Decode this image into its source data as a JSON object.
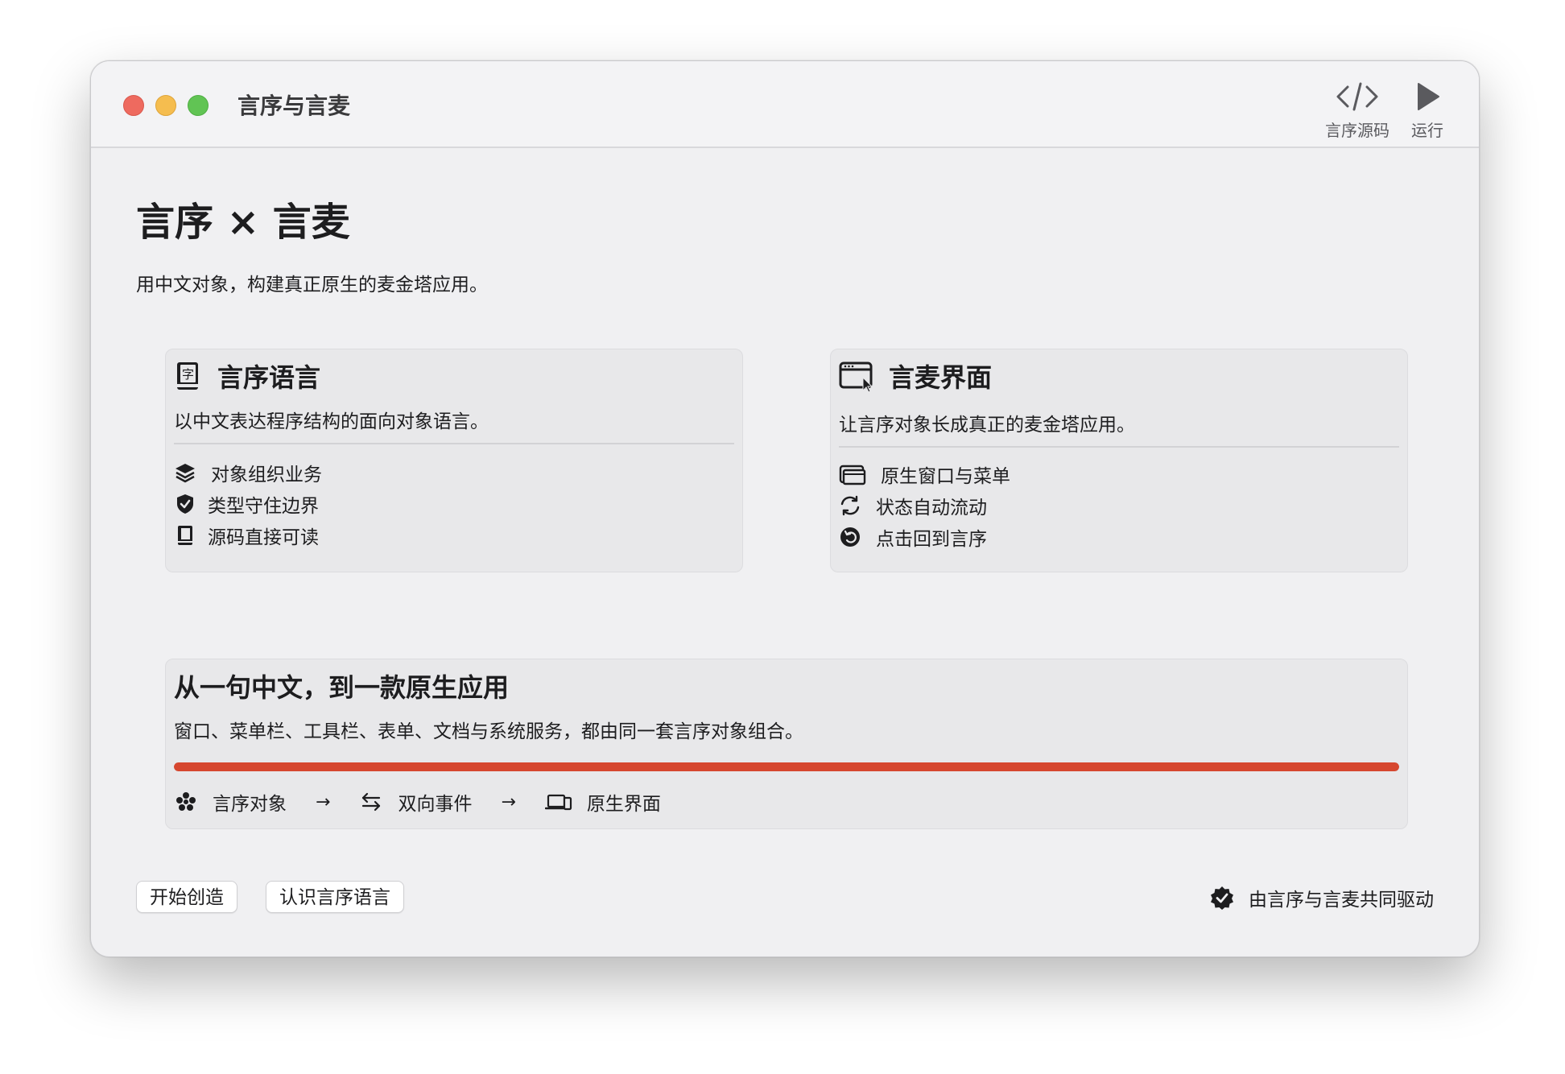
{
  "window": {
    "title": "言序与言麦",
    "toolbar": {
      "source_label": "言序源码",
      "run_label": "运行",
      "source_icon": "code-brackets-icon",
      "run_icon": "play-icon"
    }
  },
  "hero": {
    "title": "言序 × 言麦",
    "subtitle": "用中文对象，构建真正原生的麦金塔应用。"
  },
  "cards": {
    "language": {
      "title": "言序语言",
      "description": "以中文表达程序结构的面向对象语言。",
      "icon": "character-book-icon",
      "features": [
        {
          "label": "对象组织业务",
          "icon": "layers-icon"
        },
        {
          "label": "类型守住边界",
          "icon": "shield-check-icon"
        },
        {
          "label": "源码直接可读",
          "icon": "book-icon"
        }
      ]
    },
    "interface": {
      "title": "言麦界面",
      "description": "让言序对象长成真正的麦金塔应用。",
      "icon": "window-cursor-icon",
      "features": [
        {
          "label": "原生窗口与菜单",
          "icon": "windows-icon"
        },
        {
          "label": "状态自动流动",
          "icon": "sync-arrows-icon"
        },
        {
          "label": "点击回到言序",
          "icon": "return-circle-icon"
        }
      ]
    }
  },
  "flow": {
    "title": "从一句中文，到一款原生应用",
    "description": "窗口、菜单栏、工具栏、表单、文档与系统服务，都由同一套言序对象组合。",
    "progress": 1.0,
    "accent_color": "#d6472f",
    "arrow": "→",
    "steps": [
      {
        "label": "言序对象",
        "icon": "cluster-dots-icon"
      },
      {
        "label": "双向事件",
        "icon": "swap-arrows-icon"
      },
      {
        "label": "原生界面",
        "icon": "laptop-phone-icon"
      }
    ]
  },
  "actions": {
    "start_label": "开始创造",
    "learn_label": "认识言序语言"
  },
  "footer": {
    "badge_label": "由言序与言麦共同驱动",
    "badge_icon": "verified-seal-icon"
  }
}
